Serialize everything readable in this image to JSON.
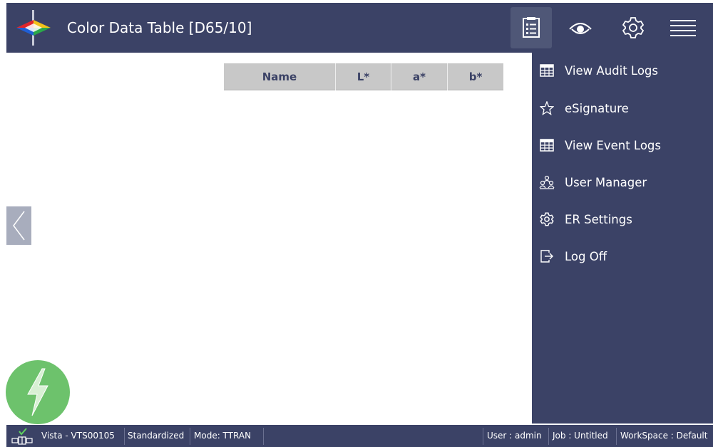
{
  "header": {
    "title": "Color Data Table [D65/10]"
  },
  "table": {
    "columns": [
      "Name",
      "L*",
      "a*",
      "b*"
    ]
  },
  "menu": {
    "items": [
      {
        "label": "View Audit Logs",
        "icon": "table-icon"
      },
      {
        "label": "eSignature",
        "icon": "star-icon"
      },
      {
        "label": "View Event Logs",
        "icon": "table-icon"
      },
      {
        "label": "User Manager",
        "icon": "users-icon"
      },
      {
        "label": "ER Settings",
        "icon": "gear-icon"
      },
      {
        "label": "Log Off",
        "icon": "logout-icon"
      }
    ]
  },
  "status": {
    "device": "Vista - VTS00105",
    "state": "Standardized",
    "mode": "Mode: TTRAN",
    "user": "User : admin",
    "job": "Job : Untitled",
    "workspace": "WorkSpace : Default"
  },
  "colors": {
    "primary": "#3b4266",
    "table_header": "#c8c8c8",
    "power": "#6dc26c"
  }
}
